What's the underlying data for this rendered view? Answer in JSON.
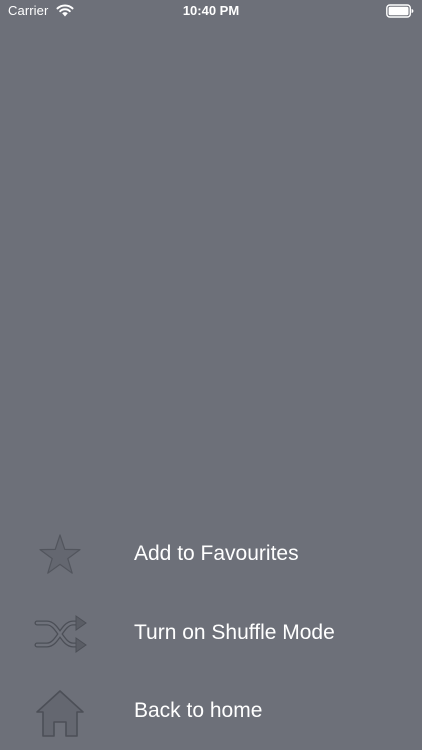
{
  "status_bar": {
    "carrier": "Carrier",
    "time": "10:40 PM",
    "wifi_icon": "wifi-icon",
    "battery_icon": "battery-icon"
  },
  "menu": {
    "items": [
      {
        "label": "Add to Favourites",
        "icon": "star-icon"
      },
      {
        "label": "Turn on Shuffle Mode",
        "icon": "shuffle-icon"
      },
      {
        "label": "Back to home",
        "icon": "home-icon"
      }
    ]
  },
  "colors": {
    "background": "#6d7079",
    "text": "#ffffff",
    "icon_fill": "#646770",
    "icon_stroke": "#4c4f57"
  }
}
